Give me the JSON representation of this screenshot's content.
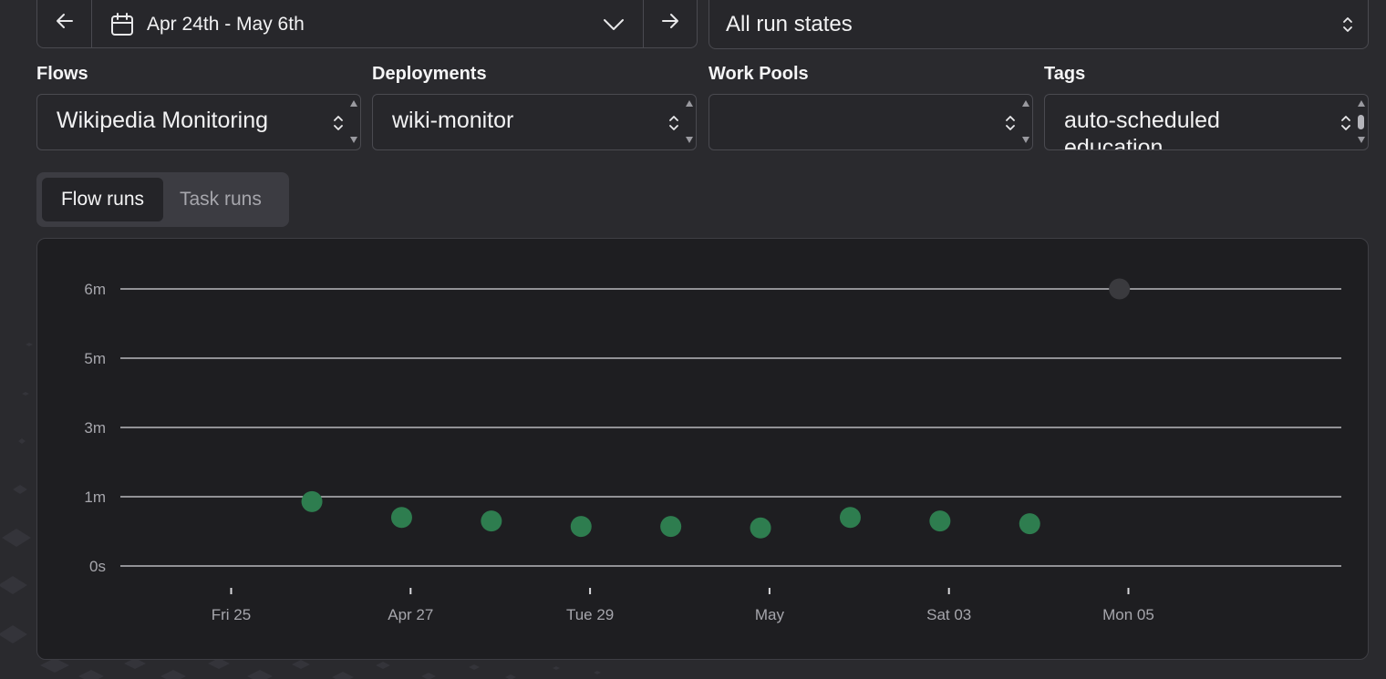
{
  "date_range": {
    "label": "Apr 24th - May 6th",
    "prev_icon": "arrow-left-icon",
    "next_icon": "arrow-right-icon",
    "calendar_icon": "calendar-icon"
  },
  "run_states": {
    "value": "All run states"
  },
  "filters": {
    "flows": {
      "label": "Flows",
      "value": "Wikipedia Monitoring"
    },
    "deployments": {
      "label": "Deployments",
      "value": "wiki-monitor"
    },
    "work_pools": {
      "label": "Work Pools",
      "value": ""
    },
    "tags": {
      "label": "Tags",
      "values": [
        "auto-scheduled",
        "education"
      ]
    }
  },
  "tabs": [
    {
      "label": "Flow runs",
      "active": true
    },
    {
      "label": "Task runs",
      "active": false
    }
  ],
  "colors": {
    "completed": "#2e7d4f",
    "scheduled": "#3a3a3e",
    "grid": "#d8d8dc"
  },
  "chart_data": {
    "type": "scatter",
    "title": "",
    "xlabel": "",
    "ylabel": "",
    "y_ticks": [
      "0s",
      "1m",
      "3m",
      "5m",
      "6m"
    ],
    "x_ticks": [
      "Fri 25",
      "Apr 27",
      "Tue 29",
      "May",
      "Sat 03",
      "Mon 05"
    ],
    "x_tick_days": [
      1,
      3,
      5,
      7,
      9,
      11
    ],
    "grid": true,
    "series": [
      {
        "state": "completed",
        "points": [
          {
            "day": 1.9,
            "y_level": 0.93
          },
          {
            "day": 2.9,
            "y_level": 0.7
          },
          {
            "day": 3.9,
            "y_level": 0.65
          },
          {
            "day": 4.9,
            "y_level": 0.57
          },
          {
            "day": 5.9,
            "y_level": 0.57
          },
          {
            "day": 6.9,
            "y_level": 0.55
          },
          {
            "day": 7.9,
            "y_level": 0.7
          },
          {
            "day": 8.9,
            "y_level": 0.65
          },
          {
            "day": 9.9,
            "y_level": 0.61
          }
        ]
      },
      {
        "state": "scheduled",
        "points": [
          {
            "day": 10.9,
            "y_level": 4.0
          }
        ]
      }
    ]
  }
}
